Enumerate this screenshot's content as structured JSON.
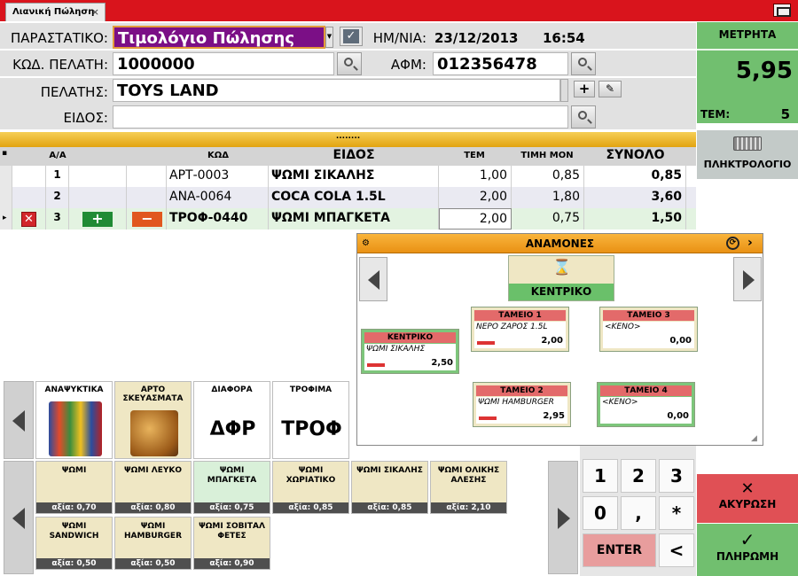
{
  "window": {
    "tab_title": "Λιανική Πώληση",
    "tab_close": "×"
  },
  "header": {
    "document_label": "ΠΑΡΑΣΤΑΤΙΚΟ:",
    "document_value": "Τιμολόγιο Πώλησης",
    "date_label": "ΗΜ/ΝΙΑ:",
    "date_value": "23/12/2013",
    "time_value": "16:54",
    "customer_code_label": "ΚΩΔ. ΠΕΛΑΤΗ:",
    "customer_code_value": "1000000",
    "afm_label": "ΑΦΜ:",
    "afm_value": "012356478",
    "customer_label": "ΠΕΛΑΤΗΣ:",
    "customer_value": "TOYS LAND",
    "item_label": "ΕΙΔΟΣ:",
    "item_value": ""
  },
  "counter": {
    "label": "ΜΕΤΡΗΤΑ",
    "total": "5,95",
    "items_label": "ΤΕΜ:",
    "items_value": "5"
  },
  "keyboard_label": "ΠΛΗΚΤΡΟΛΟΓΙΟ",
  "grid": {
    "splitter_text": "........",
    "headers": {
      "aa": "Α/Α",
      "code": "ΚΩΔ",
      "item": "ΕΙΔΟΣ",
      "qty": "ΤΕΜ",
      "unit_price": "ΤΙΜΗ ΜΟΝ",
      "total": "ΣΥΝΟΛΟ"
    },
    "rows": [
      {
        "aa": "1",
        "code": "ΑΡΤ-0003",
        "item": "ΨΩΜΙ ΣΙΚΑΛΗΣ",
        "qty": "1,00",
        "price": "0,85",
        "total": "0,85"
      },
      {
        "aa": "2",
        "code": "ΑΝΑ-0064",
        "item": "COCA COLA 1.5L",
        "qty": "2,00",
        "price": "1,80",
        "total": "3,60"
      },
      {
        "aa": "3",
        "code": "ΤΡΟΦ-0440",
        "item": "ΨΩΜΙ ΜΠΑΓΚΕΤΑ",
        "qty": "2,00",
        "price": "0,75",
        "total": "1,50"
      }
    ]
  },
  "waiting": {
    "title": "ΑΝΑΜΟΝΕΣ",
    "center_label": "ΚΕΝΤΡΙΚΟ",
    "tills": [
      {
        "title": "ΚΕΝΤΡΙΚΟ",
        "item": "ΨΩΜΙ ΣΙΚΑΛΗΣ",
        "amount": "2,50"
      },
      {
        "title": "ΤΑΜΕΙΟ 1",
        "item": "ΝΕΡΟ ΖΑΡΟΣ 1.5L",
        "amount": "2,00"
      },
      {
        "title": "ΤΑΜΕΙΟ 3",
        "item": "<ΚΕΝΟ>",
        "amount": "0,00"
      },
      {
        "title": "ΤΑΜΕΙΟ 2",
        "item": "ΨΩΜΙ HAMBURGER",
        "amount": "2,95"
      },
      {
        "title": "ΤΑΜΕΙΟ 4",
        "item": "<ΚΕΝΟ>",
        "amount": "0,00"
      }
    ]
  },
  "categories": [
    {
      "label": "ΑΝΑΨΥΚΤΙΚΑ",
      "big": ""
    },
    {
      "label": "ΑΡΤΟ ΣΚΕΥΑΣΜΑΤΑ",
      "big": ""
    },
    {
      "label": "ΔΙΑΦΟΡΑ",
      "big": "ΔΦΡ"
    },
    {
      "label": "ΤΡΟΦΙΜΑ",
      "big": "ΤΡΟΦ"
    }
  ],
  "products": [
    {
      "name": "ΨΩΜΙ",
      "price": "αξία: 0,70"
    },
    {
      "name": "ΨΩΜΙ ΛΕΥΚΟ",
      "price": "αξία: 0,80"
    },
    {
      "name": "ΨΩΜΙ ΜΠΑΓΚΕΤΑ",
      "price": "αξία: 0,75"
    },
    {
      "name": "ΨΩΜΙ ΧΩΡΙΑΤΙΚΟ",
      "price": "αξία: 0,85"
    },
    {
      "name": "ΨΩΜΙ ΣΙΚΑΛΗΣ",
      "price": "αξία: 0,85"
    },
    {
      "name": "ΨΩΜΙ ΟΛΙΚΗΣ ΑΛΕΣΗΣ",
      "price": "αξία: 2,10"
    },
    {
      "name": "ΨΩΜΙ SANDWICH",
      "price": "αξία: 0,50"
    },
    {
      "name": "ΨΩΜΙ HAMBURGER",
      "price": "αξία: 0,50"
    },
    {
      "name": "ΨΩΜΙ ΣΟΒΙΤΑΛ ΦΕΤΕΣ",
      "price": "αξία: 0,90"
    }
  ],
  "keypad": {
    "k1": "1",
    "k2": "2",
    "k3": "3",
    "k0": "0",
    "comma": ",",
    "star": "*",
    "enter": "ENTER",
    "back": "<"
  },
  "actions": {
    "cancel": "ΑΚΥΡΩΣΗ",
    "cancel_glyph": "✕",
    "pay": "ΠΛΗΡΩΜΗ",
    "pay_glyph": "✓"
  }
}
